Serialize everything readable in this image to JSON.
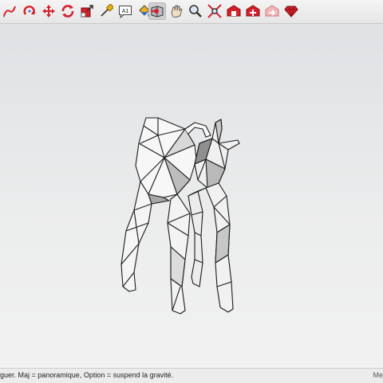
{
  "toolbar": {
    "tools": [
      {
        "id": "freehand",
        "icon": "freehand-pencil-icon"
      },
      {
        "id": "rotate",
        "icon": "rotate-icon"
      },
      {
        "id": "move",
        "icon": "move-arrows-icon"
      },
      {
        "id": "orbit",
        "icon": "orbit-icon"
      },
      {
        "id": "scale",
        "icon": "scale-icon"
      },
      {
        "id": "tape-measure",
        "icon": "tape-measure-icon"
      },
      {
        "id": "text",
        "icon": "text-label-icon",
        "label": "A1"
      },
      {
        "id": "paint-bucket",
        "icon": "paint-bucket-icon"
      },
      {
        "id": "walk",
        "icon": "walk-icon",
        "active": true
      },
      {
        "id": "pan",
        "icon": "pan-hand-icon"
      },
      {
        "id": "zoom",
        "icon": "zoom-icon"
      },
      {
        "id": "zoom-extents",
        "icon": "zoom-extents-icon"
      },
      {
        "id": "warehouse",
        "icon": "warehouse-icon"
      },
      {
        "id": "extension-warehouse",
        "icon": "extension-warehouse-icon"
      },
      {
        "id": "share-model",
        "icon": "share-model-icon"
      },
      {
        "id": "ruby-console",
        "icon": "ruby-gem-icon"
      }
    ],
    "colors": {
      "red": "#d81f2a",
      "blue": "#2f6fd6",
      "yellow": "#e7b21b"
    }
  },
  "status": {
    "text": "iguer. Maj = panoramique, Option =  suspend la gravité.",
    "right_text": "Me"
  }
}
